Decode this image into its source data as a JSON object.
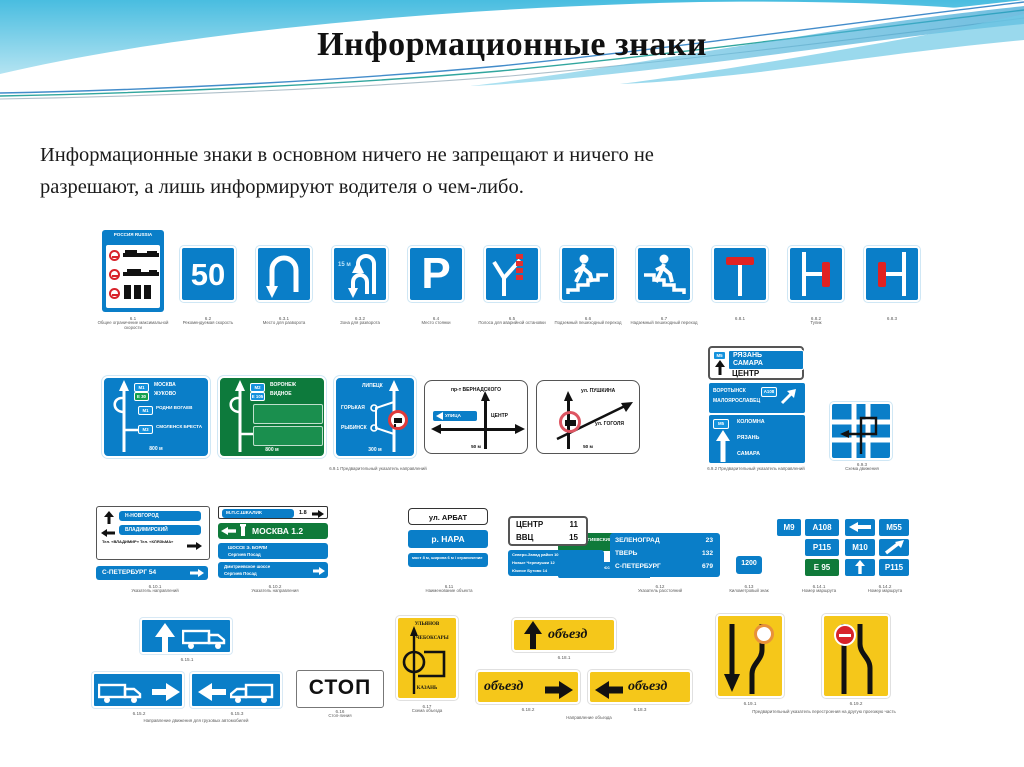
{
  "slide": {
    "title": "Информационные знаки",
    "lead_paragraph": "Информационные знаки в основном ничего не запрещают и ничего не разрешают, а лишь информируют водителя о чем-либо."
  },
  "colors": {
    "sign_blue": "#0a7ec8",
    "sign_green": "#0d7a3c",
    "sign_yellow": "#f5c71a",
    "sign_red": "#d8232a",
    "banner_top": "#57c4e5",
    "banner_teal": "#1fa39a",
    "text_dark": "#1a1a1a"
  },
  "rows": {
    "row1": [
      {
        "num": "6.1",
        "caption": "Общее ограничение максимальной скорости",
        "kind": "speed-table",
        "header": "РОССИЯ RUSSIA"
      },
      {
        "num": "6.2",
        "caption": "Рекомендуемая скорость",
        "kind": "recommended-speed",
        "value": "50"
      },
      {
        "num": "6.3.1",
        "caption": "Место для разворота",
        "kind": "u-turn"
      },
      {
        "num": "6.3.2",
        "caption": "Зона для разворота",
        "kind": "u-turn-zone",
        "distance": "15 м"
      },
      {
        "num": "6.4",
        "caption": "Место стоянки",
        "kind": "parking",
        "glyph": "P"
      },
      {
        "num": "6.5",
        "caption": "Полоса для аварийной остановки",
        "kind": "emergency-lane"
      },
      {
        "num": "6.6",
        "caption": "Подземный пешеходный переход",
        "kind": "underpass"
      },
      {
        "num": "6.7",
        "caption": "Надземный пешеходный переход",
        "kind": "overpass"
      },
      {
        "num": "6.8.1",
        "caption": "",
        "kind": "dead-end-ahead"
      },
      {
        "num": "6.8.2",
        "caption": "Тупик",
        "kind": "dead-end-right"
      },
      {
        "num": "6.8.3",
        "caption": "",
        "kind": "dead-end-left"
      }
    ],
    "row2": {
      "group_caption_left": "6.9.1  Предварительный указатель направлений",
      "group_caption_right": "6.9.2  Предварительный указатель направлений",
      "panel_a": {
        "bg": "blue",
        "shields": [
          "М1",
          "Е 30"
        ],
        "lines": [
          "МОСКВА",
          "ЖУКОВО",
          "РОДНИ ВОГАЕВ",
          "СМОЛЕНСК БРЕСТА"
        ],
        "distance": "800 м",
        "route_badges": [
          "М1",
          "М3"
        ]
      },
      "panel_b": {
        "bg": "green",
        "shields": [
          "М2",
          "Е 105"
        ],
        "lines": [
          "ВОРОНЕЖ",
          "ВИДНОЕ"
        ],
        "distance": "800 м"
      },
      "panel_c": {
        "bg": "blue",
        "lines": [
          "ЛИПЕЦК",
          "ГОРЬКАЯ",
          "РЫБИНСК"
        ],
        "distance": "300 м",
        "has_restriction": true
      },
      "panel_d": {
        "bg": "white",
        "top": "пр-т ВЕРНАДСКОГО",
        "right": "ЦЕНТР",
        "left_plate": "УЛИЦА",
        "distance": "50 м"
      },
      "panel_e": {
        "bg": "white",
        "top": "ул. ПУШКИНА",
        "diag": "ул. ГОГОЛЯ",
        "distance": "50 м"
      },
      "panel_f": {
        "num": "6.9.2",
        "blocks": [
          {
            "shield": "М5",
            "lines": [
              "РЯЗАНЬ",
              "САМАРА"
            ],
            "extra": "ЦЕНТР"
          },
          {
            "shield": "А108",
            "lines": [
              "ВОРОТЫНСК",
              "МАЛОЯРОСЛАВЕЦ"
            ]
          },
          {
            "shield": "М5",
            "lines": [
              "КОЛОМНА",
              "РЯЗАНЬ",
              "САМАРА"
            ]
          }
        ]
      },
      "panel_g": {
        "num": "6.9.3",
        "caption": "Схема движения"
      }
    },
    "row3": {
      "captions": [
        {
          "num": "6.10.1",
          "text": "Указатель направлений"
        },
        {
          "num": "6.10.2",
          "text": "Указатель направления"
        },
        {
          "num": "6.11",
          "text": "Наименование объекта"
        },
        {
          "num": "6.12",
          "text": "Указатель расстояний"
        },
        {
          "num": "6.13",
          "text": "Километровый знак"
        },
        {
          "num": "6.14.1",
          "text": "Номер маршрута"
        },
        {
          "num": "6.14.2",
          "text": "Номер маршрута"
        }
      ],
      "plate_group_a": {
        "lines": [
          "Н-НОВГОРОД",
          "ВЛАДИМИРСКИЙ"
        ],
        "note": "Тел. «ВЛАДИМИР» Тел. «КЛЯЗЬМА»"
      },
      "plate_spb": "С-ПЕТЕРБУРГ 54",
      "plate_b1": {
        "text": "М.П.С.ШКАЛИК",
        "dist": "1.8"
      },
      "plate_b2": {
        "text": "МОСКВА 1.2",
        "bg": "green"
      },
      "plate_b3": {
        "lines": [
          "ШОССЕ Э. БОРЛИ",
          "Сергиев Посад"
        ]
      },
      "plate_b4": {
        "lines": [
          "Дмитриевское шоссе",
          "Сергиев Посад"
        ]
      },
      "plate_c1": {
        "text": "СЕРГИЕВСКИЙ ЗАПОВЕДНИК",
        "bg": "green"
      },
      "plate_c2": {
        "text": "Дмитриевское шоссе"
      },
      "plate_arbat": "ул. АРБАТ",
      "plate_nara": "р. НАРА",
      "plate_nara_sub": "мост 8 м, ширина 6 м / ограничение",
      "distance_table": [
        {
          "place": "ЦЕНТР",
          "km": "11"
        },
        {
          "place": "ВВЦ",
          "km": "15"
        }
      ],
      "distance_table_sub": [
        "Северо-Запад район 10",
        "Новые Черемушки 12",
        "Южное Бутово 14"
      ],
      "distance_big": [
        {
          "place": "ЗЕЛЕНОГРАД",
          "km": "23"
        },
        {
          "place": "ТВЕРЬ",
          "km": "132"
        },
        {
          "place": "С-ПЕТЕРБУРГ",
          "km": "679"
        }
      ],
      "kilometer_marker": "1200",
      "route_badges_a": [
        "М9",
        "А108",
        "Р115",
        "Е 95"
      ],
      "route_badges_b": [
        "М55",
        "М10",
        "Р115"
      ]
    },
    "row4": {
      "bus_lane": {
        "num": "6.15.1",
        "caption": "Направление движения для грузовых автомобилей"
      },
      "bus_lane_left": {
        "num": "6.15.2"
      },
      "bus_lane_right": {
        "num": "6.15.3"
      },
      "stop_line": {
        "num": "6.16",
        "caption": "Стоп-линия",
        "text": "СТОП"
      },
      "detour_scheme": {
        "num": "6.17",
        "caption": "Схема объезда",
        "labels": [
          "УЛЬЯНОВ",
          "ЧЕБОКСАРЫ",
          "КАЗАНЬ"
        ]
      },
      "detour_up": {
        "num": "6.18.1",
        "text": "объезд"
      },
      "detour_right": {
        "num": "6.18.2",
        "text": "объезд"
      },
      "detour_left": {
        "num": "6.18.3",
        "text": "объезд"
      },
      "detour_caption": "Направление объезда",
      "lane_change_1": {
        "num": "6.19.1"
      },
      "lane_change_2": {
        "num": "6.19.2"
      },
      "lane_change_caption": "Предварительный указатель перестроения на другую проезжую часть"
    }
  }
}
